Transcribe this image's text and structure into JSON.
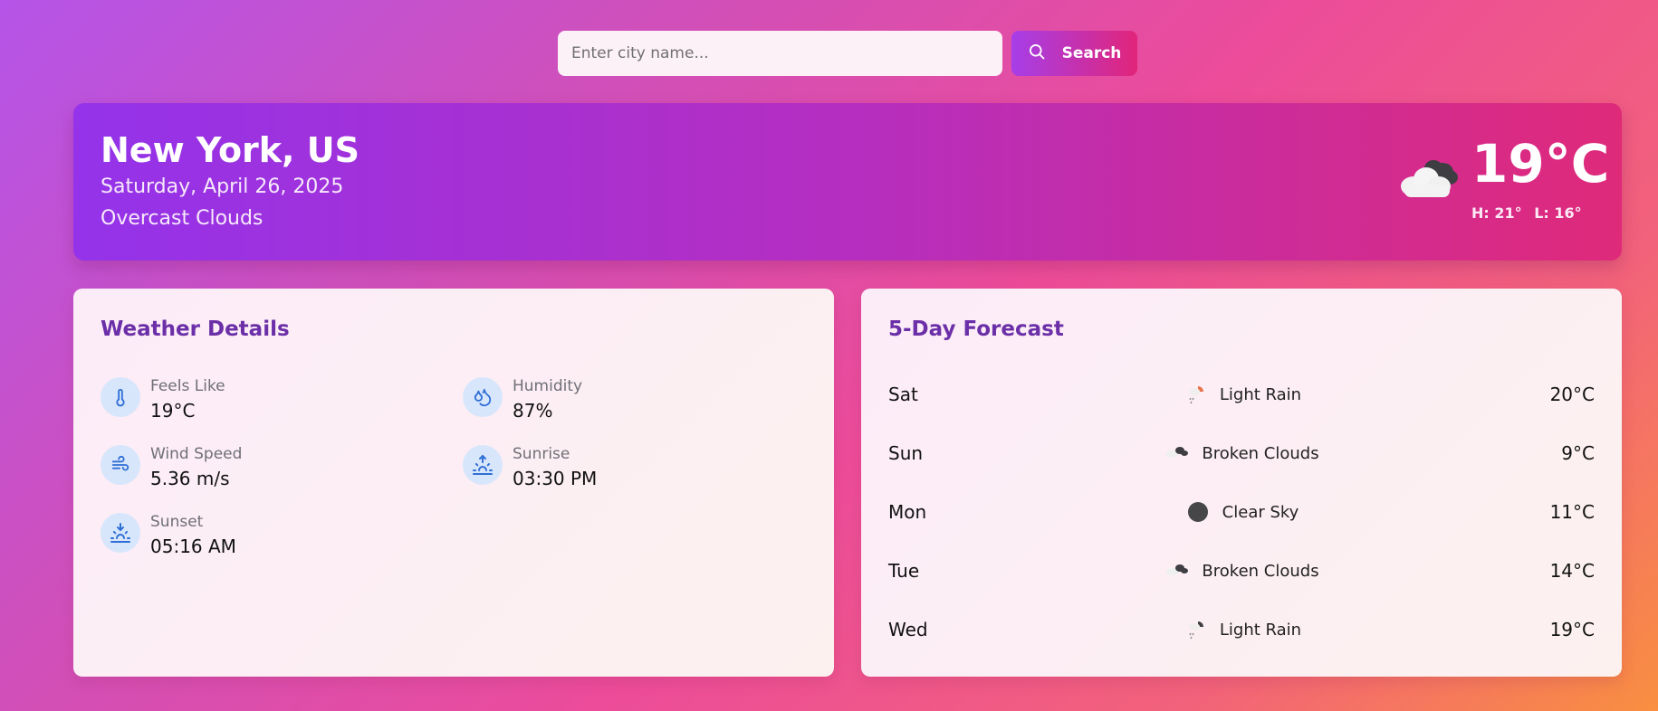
{
  "search": {
    "placeholder": "Enter city name...",
    "value": "",
    "button_label": "Search"
  },
  "current": {
    "city": "New York, US",
    "date": "Saturday, April 26, 2025",
    "description": "Overcast Clouds",
    "temperature": "19°C",
    "high": "H: 21°",
    "low": "L: 16°",
    "icon": "overcast-cloud-icon"
  },
  "details": {
    "title": "Weather Details",
    "items": [
      {
        "label": "Feels Like",
        "value": "19°C",
        "icon": "thermometer-icon"
      },
      {
        "label": "Humidity",
        "value": "87%",
        "icon": "droplets-icon"
      },
      {
        "label": "Wind Speed",
        "value": "5.36 m/s",
        "icon": "wind-icon"
      },
      {
        "label": "Sunrise",
        "value": "03:30 PM",
        "icon": "sunrise-icon"
      },
      {
        "label": "Sunset",
        "value": "05:16 AM",
        "icon": "sunset-icon"
      }
    ]
  },
  "forecast": {
    "title": "5-Day Forecast",
    "days": [
      {
        "day": "Sat",
        "description": "Light Rain",
        "temp": "20°C",
        "icon": "light-rain-icon"
      },
      {
        "day": "Sun",
        "description": "Broken Clouds",
        "temp": "9°C",
        "icon": "broken-clouds-icon"
      },
      {
        "day": "Mon",
        "description": "Clear Sky",
        "temp": "11°C",
        "icon": "clear-sky-icon"
      },
      {
        "day": "Tue",
        "description": "Broken Clouds",
        "temp": "14°C",
        "icon": "broken-clouds-icon"
      },
      {
        "day": "Wed",
        "description": "Light Rain",
        "temp": "19°C",
        "icon": "light-rain-icon"
      }
    ]
  },
  "colors": {
    "accent": "#6b2fa8",
    "icon_blue": "#2f6fd6",
    "card_start": "#9433ea",
    "card_end": "#df2a7a"
  }
}
